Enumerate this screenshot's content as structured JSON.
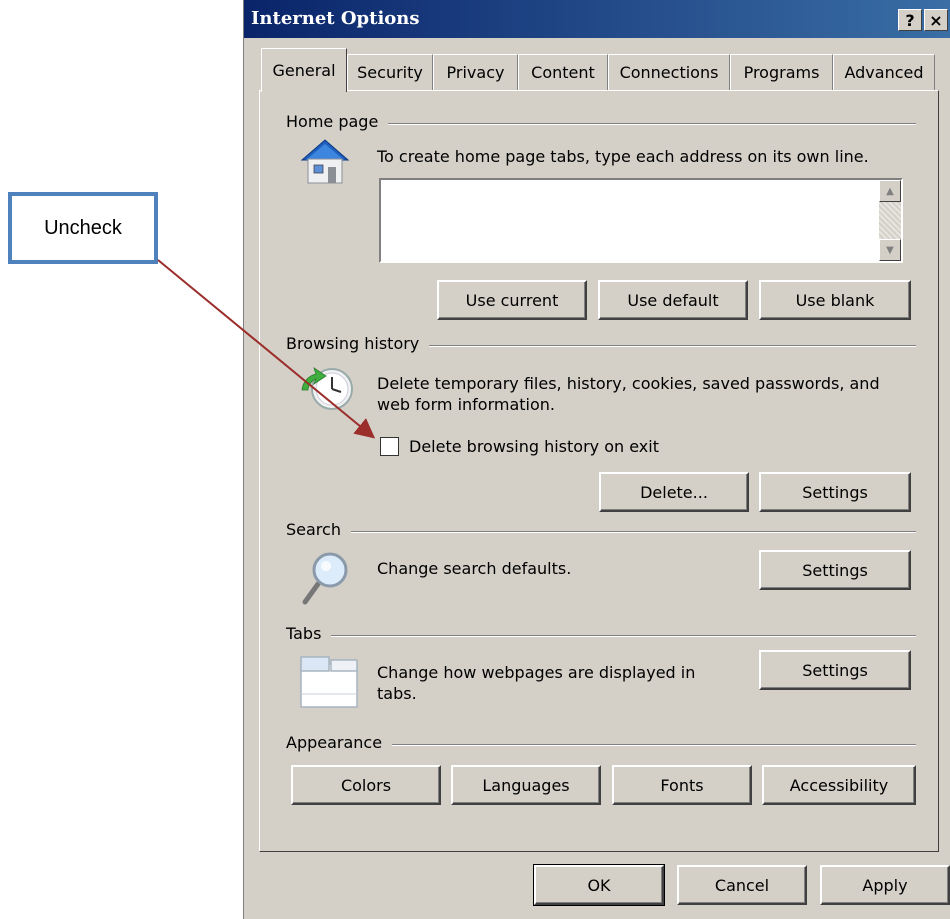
{
  "callout": {
    "text": "Uncheck"
  },
  "window": {
    "title": "Internet Options",
    "help_glyph": "?",
    "close_glyph": "×"
  },
  "tabs": [
    {
      "label": "General",
      "active": true
    },
    {
      "label": "Security"
    },
    {
      "label": "Privacy"
    },
    {
      "label": "Content"
    },
    {
      "label": "Connections"
    },
    {
      "label": "Programs"
    },
    {
      "label": "Advanced"
    }
  ],
  "home_page": {
    "heading": "Home page",
    "description": "To create home page tabs, type each address on its own line.",
    "value": "",
    "buttons": {
      "use_current": "Use current",
      "use_default": "Use default",
      "use_blank": "Use blank"
    },
    "icon": "house-icon"
  },
  "browsing_history": {
    "heading": "Browsing history",
    "description": "Delete temporary files, history, cookies, saved passwords, and web form information.",
    "checkbox_label": "Delete browsing history on exit",
    "checkbox_checked": false,
    "buttons": {
      "delete": "Delete...",
      "settings": "Settings"
    },
    "icon": "history-clock-icon"
  },
  "search": {
    "heading": "Search",
    "description": "Change search defaults.",
    "buttons": {
      "settings": "Settings"
    },
    "icon": "magnifier-icon"
  },
  "tabs_section": {
    "heading": "Tabs",
    "description": "Change how webpages are displayed in tabs.",
    "buttons": {
      "settings": "Settings"
    },
    "icon": "tabs-window-icon"
  },
  "appearance": {
    "heading": "Appearance",
    "buttons": {
      "colors": "Colors",
      "languages": "Languages",
      "fonts": "Fonts",
      "accessibility": "Accessibility"
    }
  },
  "footer": {
    "ok": "OK",
    "cancel": "Cancel",
    "apply": "Apply"
  },
  "colors": {
    "title_start": "#0a246a",
    "title_end": "#3a6ea5",
    "dialog_bg": "#d4d0c8",
    "callout_border": "#4f81bd",
    "arrow": "#9b2d2a"
  }
}
